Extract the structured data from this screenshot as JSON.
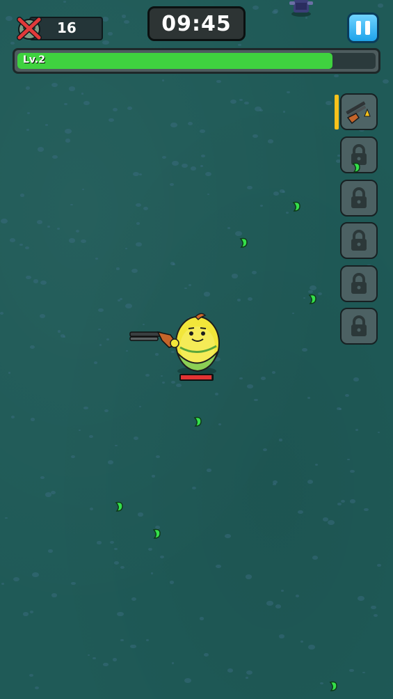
{
  "hud": {
    "kill_count": "16",
    "kill_icon": "zombie-skull-crossed-icon",
    "timer": "09:45",
    "pause_icon": "pause-icon"
  },
  "xp": {
    "level_label": "Lv.2",
    "progress_fraction": 0.88,
    "fill_color": "#3fd23f"
  },
  "skills": {
    "weapon_icon": "shotgun-icon",
    "weapon_charge_fraction": 1.0,
    "locked_slots": [
      "lock-icon",
      "lock-icon",
      "lock-icon",
      "lock-icon",
      "lock-icon"
    ]
  },
  "player": {
    "character": "corn-hero",
    "weapon": "shotgun",
    "health_fraction": 0.97,
    "health_color": "#e33333"
  },
  "pickups": {
    "type": "green-xp-gem",
    "count": 8
  },
  "colors": {
    "ground": "#1f5a57",
    "xp_green": "#3fd23f",
    "pause_blue": "#1ea3ea",
    "charge_yellow": "#f7c21b"
  }
}
